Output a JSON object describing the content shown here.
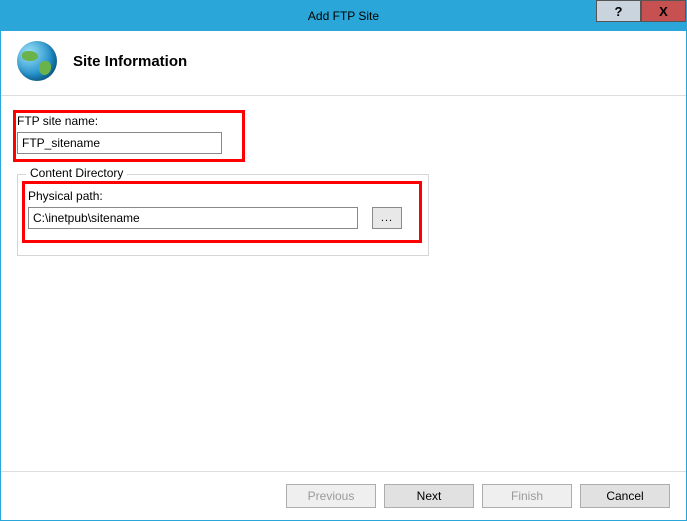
{
  "window": {
    "title": "Add FTP Site",
    "help_label": "?",
    "close_label": "X"
  },
  "header": {
    "title": "Site Information",
    "icon": "globe-icon"
  },
  "form": {
    "site_name_label": "FTP site name:",
    "site_name_value": "FTP_sitename",
    "content_dir_legend": "Content Directory",
    "physical_path_label": "Physical path:",
    "physical_path_value": "C:\\inetpub\\sitename",
    "browse_label": "..."
  },
  "buttons": {
    "previous": "Previous",
    "next": "Next",
    "finish": "Finish",
    "cancel": "Cancel"
  }
}
